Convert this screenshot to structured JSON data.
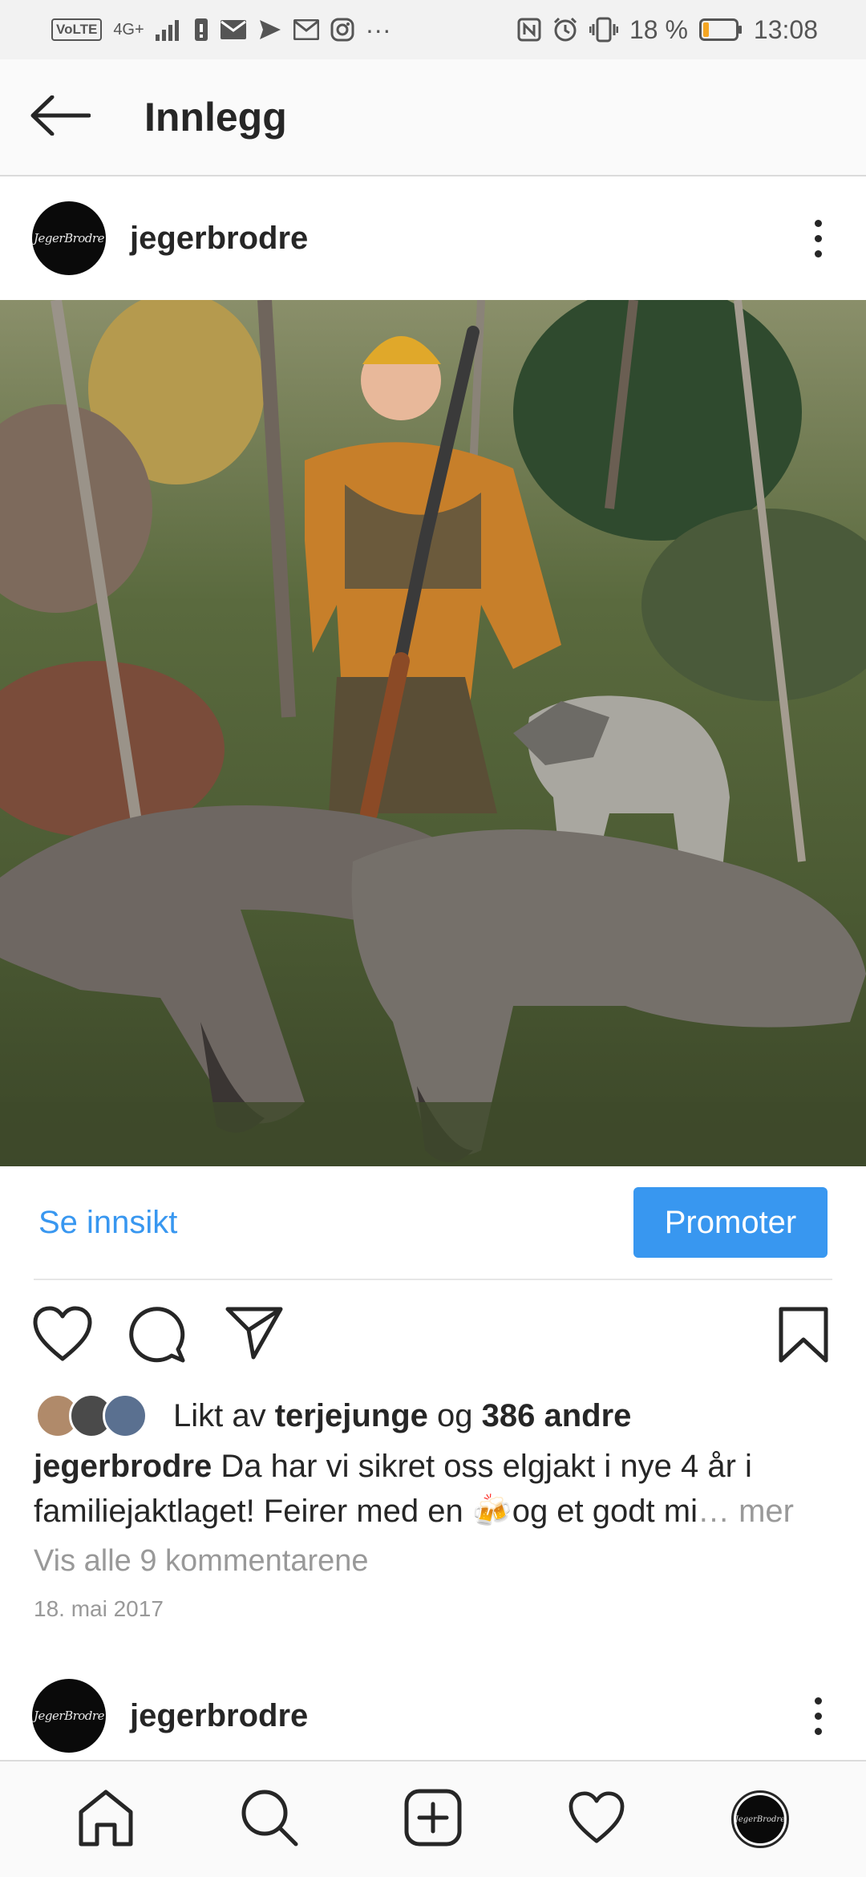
{
  "status_bar": {
    "network": "VoLTE",
    "signal": "4G+",
    "battery_percent": "18 %",
    "time": "13:08",
    "battery_level": 0.18,
    "battery_color": "#f5a623",
    "left_icons": [
      "sim-icon",
      "mail-icon",
      "send-icon",
      "gmail-icon",
      "instagram-icon",
      "more-dots-icon"
    ],
    "right_icons": [
      "nfc-icon",
      "alarm-icon",
      "vibrate-icon",
      "battery-icon"
    ]
  },
  "header": {
    "title": "Innlegg",
    "back_icon": "arrow-left-icon"
  },
  "post": {
    "avatar_text": "JegerBrodre",
    "username": "jegerbrodre",
    "insights_label": "Se innsikt",
    "promote_label": "Promoter",
    "liked_prefix": "Likt av",
    "liked_user": "terjejunge",
    "liked_joiner": "og",
    "liked_others": "386 andre",
    "caption_user": "jegerbrodre",
    "caption_text": "Da har vi sikret oss elgjakt i nye 4 år i familiejaktlaget! Feirer med en 🍻og et godt mi",
    "caption_more": "… mer",
    "comments_link": "Vis alle 9 kommentarene",
    "date": "18. mai 2017",
    "action_icons": [
      "heart-icon",
      "comment-icon",
      "share-icon",
      "bookmark-icon"
    ]
  },
  "next_post": {
    "avatar_text": "JegerBrodre",
    "username": "jegerbrodre"
  },
  "bottom_nav": {
    "items": [
      "home-icon",
      "search-icon",
      "add-post-icon",
      "activity-icon",
      "profile-avatar"
    ],
    "profile_avatar_text": "JegerBrodre"
  },
  "colors": {
    "accent": "#3897f0",
    "text": "#262626",
    "muted": "#999999"
  }
}
